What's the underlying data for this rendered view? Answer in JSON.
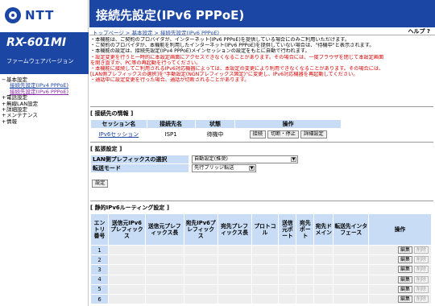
{
  "brand": {
    "name": "NTT",
    "color": "#1c46a4"
  },
  "model": "RX-601MI",
  "fw_label": "ファームウェアバージョン",
  "menu": [
    {
      "label": "基本設定",
      "kind": "top"
    },
    {
      "label": "接続先設定(IPv4 PPPoE)",
      "kind": "sub"
    },
    {
      "label": "接続先設定(IPv6 PPPoE)",
      "kind": "sub-active"
    },
    {
      "label": "電話設定",
      "kind": "top"
    },
    {
      "label": "無線LAN設定",
      "kind": "top"
    },
    {
      "label": "詳細設定",
      "kind": "top"
    },
    {
      "label": "メンテナンス",
      "kind": "top"
    },
    {
      "label": "情報",
      "kind": "top"
    }
  ],
  "header": {
    "title": "接続先設定(IPv6 PPPoE)"
  },
  "breadcrumb": "トップページ > 基本設定 > 接続先設定(IPv6 PPPoE)",
  "help": "ヘルプ ?",
  "notes": [
    {
      "text": "・本機能は、ご契約のプロバイダが、インターネット(IPv6 PPPoE)を提供している場合にのみご利用いただけます。",
      "color": "black"
    },
    {
      "text": "・ご契約のプロバイダが、本機能を利用したインターネット(IPv6 PPPoE)を提供していない場合は、\"待機中\"と表示されます。",
      "color": "black"
    },
    {
      "text": "・本機能の設定は、接続先設定(IPv4 PPPoE)メインセッションの設定をもとに自動で行われます。",
      "color": "black"
    },
    {
      "text": "・設定変更を行うと一時的に本設定画面にアクセスできなくなることがあります。その場合には、一度ブラウザを閉じて本設定画面",
      "color": "red"
    },
    {
      "text": "を開き直すか、PC等の再起動を行ってください。",
      "color": "red"
    },
    {
      "text": "・本機能に接続してご利用されるIPv6対応機器によっては、本設定の変更により利用できなくなることがあります。その場合には、",
      "color": "red"
    },
    {
      "text": "[LAN側プレフィックスの選択]を\"手動設定(NGNプレフィックス固定)\"に変更し、IPv6対応機器を再起動してください。",
      "color": "red"
    },
    {
      "text": "・通話中に設定変更を行った場合、通話が切断されることがあります。",
      "color": "red"
    }
  ],
  "connection": {
    "section_title": "[ 接続先の情報 ]",
    "headers": [
      "セッション名",
      "接続先名",
      "状態",
      "操作"
    ],
    "row": {
      "session": "IPv6セッション",
      "dest": "ISP1",
      "status": "待機中"
    },
    "buttons": [
      "接続",
      "切断・停止",
      "詳細設定"
    ]
  },
  "extended": {
    "section_title": "[ 拡張設定 ]",
    "rows": [
      {
        "label": "LAN側プレフィックスの選択",
        "value": "自動設定(推奨)"
      },
      {
        "label": "転送モード",
        "value": "先行ブリッジ転送"
      }
    ],
    "set_button": "設定"
  },
  "static_route": {
    "section_title": "[ 静的IPv6ルーティング設定 ]",
    "headers": [
      "エントリ番号",
      "送信元IPv6プレフィックス",
      "送信元プレフィックス長",
      "宛先IPv6プレフィックス",
      "宛先プレフィックス長",
      "プロトコル",
      "送信元ポート",
      "宛先ポート",
      "宛先ドメイン",
      "転送先インタフェース",
      "操作"
    ],
    "rows": [
      "1",
      "2",
      "3",
      "4",
      "5",
      "6"
    ],
    "edit_label": "編集",
    "delete_label": "削除"
  }
}
